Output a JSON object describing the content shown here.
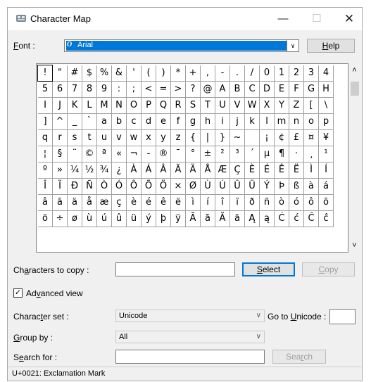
{
  "window": {
    "title": "Character Map",
    "minimize_glyph": "—",
    "maximize_glyph": "☐",
    "close_glyph": "✕"
  },
  "font": {
    "label_pre": "",
    "label_u": "F",
    "label_post": "ont :",
    "value": "Arial",
    "help_pre": "",
    "help_u": "H",
    "help_post": "elp"
  },
  "grid": {
    "rows": [
      [
        "!",
        "\"",
        "#",
        "$",
        "%",
        "&",
        "'",
        "(",
        ")",
        "*",
        "+",
        ",",
        "-",
        ".",
        "/",
        "0",
        "1",
        "2",
        "3",
        "4"
      ],
      [
        "5",
        "6",
        "7",
        "8",
        "9",
        ":",
        ";",
        "<",
        "=",
        ">",
        "?",
        "@",
        "A",
        "B",
        "C",
        "D",
        "E",
        "F",
        "G",
        "H"
      ],
      [
        "I",
        "J",
        "K",
        "L",
        "M",
        "N",
        "O",
        "P",
        "Q",
        "R",
        "S",
        "T",
        "U",
        "V",
        "W",
        "X",
        "Y",
        "Z",
        "[",
        "\\"
      ],
      [
        "]",
        "^",
        "_",
        "`",
        "a",
        "b",
        "c",
        "d",
        "e",
        "f",
        "g",
        "h",
        "i",
        "j",
        "k",
        "l",
        "m",
        "n",
        "o",
        "p"
      ],
      [
        "q",
        "r",
        "s",
        "t",
        "u",
        "v",
        "w",
        "x",
        "y",
        "z",
        "{",
        "|",
        "}",
        "~",
        " ",
        "¡",
        "¢",
        "£",
        "¤",
        "¥"
      ],
      [
        "¦",
        "§",
        "¨",
        "©",
        "ª",
        "«",
        "¬",
        "-",
        "®",
        "¯",
        "°",
        "±",
        "²",
        "³",
        "´",
        "µ",
        "¶",
        "·",
        "¸",
        "¹"
      ],
      [
        "º",
        "»",
        "¼",
        "½",
        "¾",
        "¿",
        "À",
        "Á",
        "Â",
        "Ã",
        "Ä",
        "Å",
        "Æ",
        "Ç",
        "È",
        "É",
        "Ê",
        "Ë",
        "Ì",
        "Í"
      ],
      [
        "Î",
        "Ï",
        "Ð",
        "Ñ",
        "Ò",
        "Ó",
        "Ô",
        "Õ",
        "Ö",
        "×",
        "Ø",
        "Ù",
        "Ú",
        "Û",
        "Ü",
        "Ý",
        "Þ",
        "ß",
        "à",
        "á"
      ],
      [
        "â",
        "ã",
        "ä",
        "å",
        "æ",
        "ç",
        "è",
        "é",
        "ê",
        "ë",
        "ì",
        "í",
        "î",
        "ï",
        "ð",
        "ñ",
        "ò",
        "ó",
        "ô",
        "õ"
      ],
      [
        "ö",
        "÷",
        "ø",
        "ù",
        "ú",
        "û",
        "ü",
        "ý",
        "þ",
        "ÿ",
        "Ā",
        "ā",
        "Ă",
        "ă",
        "Ą",
        "ą",
        "Ć",
        "ć",
        "Ĉ",
        "ĉ"
      ]
    ],
    "selected": "!"
  },
  "scroll": {
    "up": "˄",
    "down": "˅"
  },
  "copy": {
    "label_pre": "Ch",
    "label_u": "a",
    "label_post": "racters to copy :",
    "value": "",
    "select_pre": "",
    "select_u": "S",
    "select_post": "elect",
    "copy_pre": "",
    "copy_u": "C",
    "copy_post": "opy"
  },
  "advanced": {
    "checked": true,
    "check_glyph": "✓",
    "label_pre": "Ad",
    "label_u": "v",
    "label_post": "anced view"
  },
  "charset": {
    "label_pre": "Charac",
    "label_u": "t",
    "label_post": "er set :",
    "value": "Unicode",
    "arrow": "∨",
    "goto_pre": "Go to ",
    "goto_u": "U",
    "goto_post": "nicode :",
    "goto_value": ""
  },
  "groupby": {
    "label_pre": "",
    "label_u": "G",
    "label_post": "roup by :",
    "value": "All",
    "arrow": "∨"
  },
  "search": {
    "label_pre": "S",
    "label_u": "e",
    "label_post": "arch for :",
    "value": "",
    "button_pre": "Sea",
    "button_u": "r",
    "button_post": "ch"
  },
  "status": {
    "text": "U+0021: Exclamation Mark"
  }
}
